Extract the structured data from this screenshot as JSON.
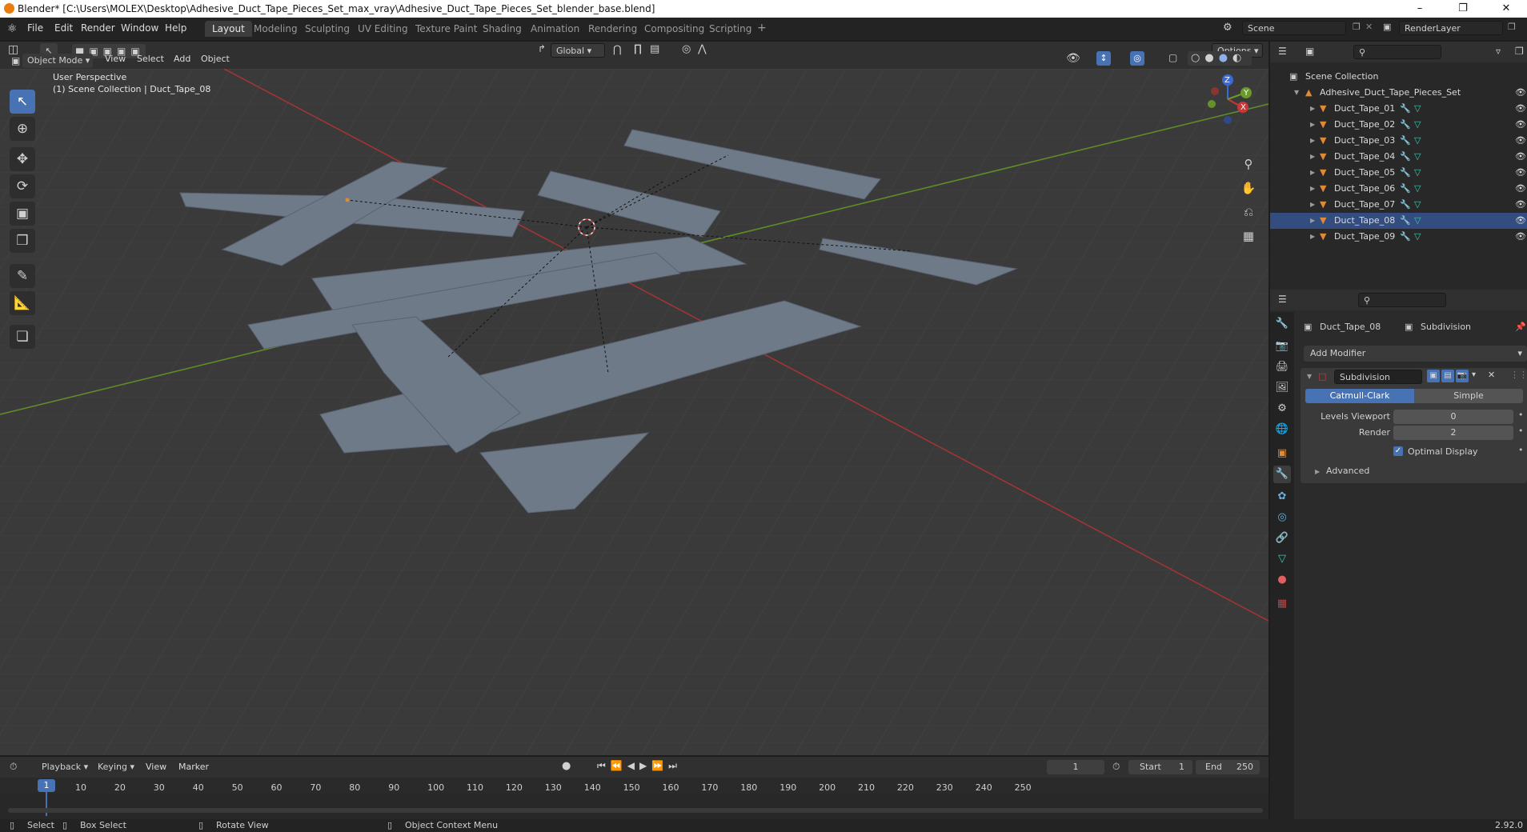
{
  "title": "Blender* [C:\\Users\\MOLEX\\Desktop\\Adhesive_Duct_Tape_Pieces_Set_max_vray\\Adhesive_Duct_Tape_Pieces_Set_blender_base.blend]",
  "menus": [
    "File",
    "Edit",
    "Render",
    "Window",
    "Help"
  ],
  "workspaces": [
    "Layout",
    "Modeling",
    "Sculpting",
    "UV Editing",
    "Texture Paint",
    "Shading",
    "Animation",
    "Rendering",
    "Compositing",
    "Scripting"
  ],
  "active_workspace": "Layout",
  "scene": "Scene",
  "render_layer": "RenderLayer",
  "toolbar": {
    "orientation": "Global",
    "options": "Options"
  },
  "viewport_header": {
    "mode": "Object Mode",
    "menus": [
      "View",
      "Select",
      "Add",
      "Object"
    ]
  },
  "viewport": {
    "perspective": "User Perspective",
    "collection_info": "(1) Scene Collection | Duct_Tape_08"
  },
  "gizmo": {
    "x": "X",
    "y": "Y",
    "z": "Z"
  },
  "outliner": {
    "root": "Scene Collection",
    "collection": "Adhesive_Duct_Tape_Pieces_Set",
    "objects": [
      "Duct_Tape_01",
      "Duct_Tape_02",
      "Duct_Tape_03",
      "Duct_Tape_04",
      "Duct_Tape_05",
      "Duct_Tape_06",
      "Duct_Tape_07",
      "Duct_Tape_08",
      "Duct_Tape_09"
    ],
    "selected": "Duct_Tape_08"
  },
  "properties": {
    "object": "Duct_Tape_08",
    "modifier_tab": "Subdivision",
    "add_modifier": "Add Modifier",
    "modifier_name": "Subdivision",
    "type_options": [
      "Catmull-Clark",
      "Simple"
    ],
    "levels_viewport_label": "Levels Viewport",
    "levels_viewport": "0",
    "render_label": "Render",
    "render": "2",
    "optimal_display": "Optimal Display",
    "advanced": "Advanced"
  },
  "timeline": {
    "menus": [
      "Playback",
      "Keying",
      "View",
      "Marker"
    ],
    "current_frame": "1",
    "start_label": "Start",
    "start": "1",
    "end_label": "End",
    "end": "250",
    "ticks": [
      "10",
      "20",
      "30",
      "40",
      "50",
      "60",
      "70",
      "80",
      "90",
      "100",
      "110",
      "120",
      "130",
      "140",
      "150",
      "160",
      "170",
      "180",
      "190",
      "200",
      "210",
      "220",
      "230",
      "240",
      "250"
    ],
    "playhead": "1"
  },
  "status": {
    "select": "Select",
    "box_select": "Box Select",
    "rotate_view": "Rotate View",
    "context_menu": "Object Context Menu",
    "version": "2.92.0"
  },
  "colors": {
    "accent": "#4772b3",
    "x_axis": "#c83838",
    "y_axis": "#6a9a2a",
    "z_axis": "#3a6ad8",
    "tape": "#6f7a88",
    "mesh_icon": "#e08a36",
    "modifier_icon": "#6ab0e0",
    "data_icon": "#46c4b0"
  }
}
